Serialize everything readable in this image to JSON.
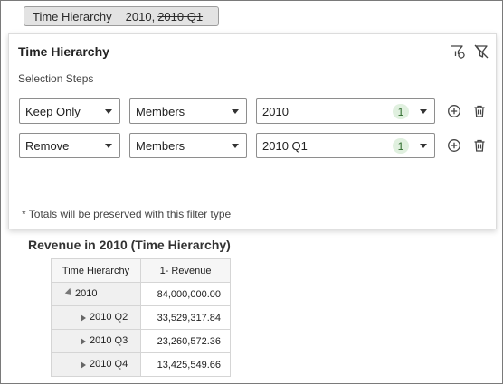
{
  "filter_pill": {
    "label": "Time Hierarchy",
    "value": "2010,",
    "struck_value": "2010 Q1"
  },
  "panel": {
    "title": "Time Hierarchy",
    "steps_label": "Selection Steps",
    "header_icons": [
      "filter-settings-icon",
      "clear-filter-icon"
    ],
    "steps": [
      {
        "action": "Keep Only",
        "type": "Members",
        "value": "2010",
        "count": "1"
      },
      {
        "action": "Remove",
        "type": "Members",
        "value": "2010 Q1",
        "count": "1"
      }
    ],
    "note": "* Totals will be preserved with this filter type"
  },
  "report": {
    "title": "Revenue in 2010 (Time Hierarchy)",
    "columns": [
      "Time Hierarchy",
      "1- Revenue"
    ],
    "rows": [
      {
        "label": "2010",
        "value": "84,000,000.00",
        "level": 0,
        "expanded": true
      },
      {
        "label": "2010 Q2",
        "value": "33,529,317.84",
        "level": 1,
        "expanded": false
      },
      {
        "label": "2010 Q3",
        "value": "23,260,572.36",
        "level": 1,
        "expanded": false
      },
      {
        "label": "2010 Q4",
        "value": "13,425,549.66",
        "level": 1,
        "expanded": false
      }
    ]
  },
  "colors": {
    "badge_bg": "#e0f0df",
    "badge_text": "#2f6b2d",
    "pill_bg": "#e3e3e3"
  }
}
